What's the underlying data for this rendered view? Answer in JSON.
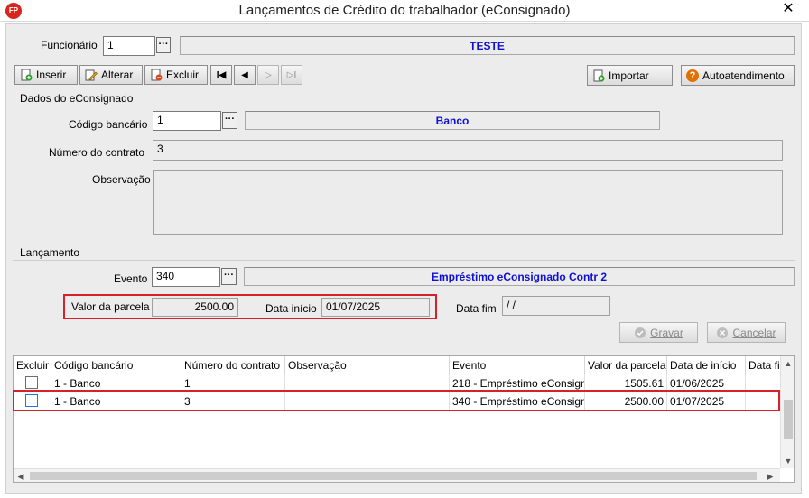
{
  "window": {
    "title": "Lançamentos de Crédito do trabalhador (eConsignado)",
    "app_badge": "FP",
    "close_glyph": "✕"
  },
  "funcionario": {
    "label": "Funcionário",
    "code": "1",
    "name": "TESTE",
    "lookup": "···"
  },
  "toolbar": {
    "inserir": "Inserir",
    "alterar": "Alterar",
    "excluir": "Excluir",
    "importar": "Importar",
    "autoatendimento": "Autoatendimento",
    "first_glyph": "I◀",
    "prev_glyph": "◀",
    "next_glyph": "▷",
    "last_glyph": "▷I"
  },
  "econsignado": {
    "section_title": "Dados do eConsignado",
    "codigo_bancario_label": "Código bancário",
    "codigo_bancario_value": "1",
    "banco_name": "Banco",
    "numero_contrato_label": "Número do contrato",
    "numero_contrato_value": "3",
    "observacao_label": "Observação",
    "observacao_value": ""
  },
  "lancamento": {
    "section_title": "Lançamento",
    "evento_label": "Evento",
    "evento_value": "340",
    "evento_name": "Empréstimo eConsignado Contr 2",
    "valor_parcela_label": "Valor da parcela",
    "valor_parcela_value": "2500.00",
    "data_inicio_label": "Data início",
    "data_inicio_value": "01/07/2025",
    "data_fim_label": "Data fim",
    "data_fim_value": " / /",
    "gravar": "Gravar",
    "cancelar": "Cancelar"
  },
  "grid": {
    "columns": [
      "Excluir",
      "Código bancário",
      "Número do contrato",
      "Observação",
      "Evento",
      "Valor da parcela",
      "Data de início",
      "Data fi"
    ],
    "rows": [
      {
        "codigo": "1 - Banco",
        "contrato": "1",
        "observacao": "",
        "evento": "218 - Empréstimo eConsign",
        "valor": "1505.61",
        "inicio": "01/06/2025",
        "fim": ""
      },
      {
        "codigo": "1 - Banco",
        "contrato": "3",
        "observacao": "",
        "evento": "340 - Empréstimo eConsign",
        "valor": "2500.00",
        "inicio": "01/07/2025",
        "fim": ""
      }
    ]
  },
  "colors": {
    "accent_name": "#1010d0",
    "highlight": "#d8202a",
    "help_icon": "#e07000"
  }
}
